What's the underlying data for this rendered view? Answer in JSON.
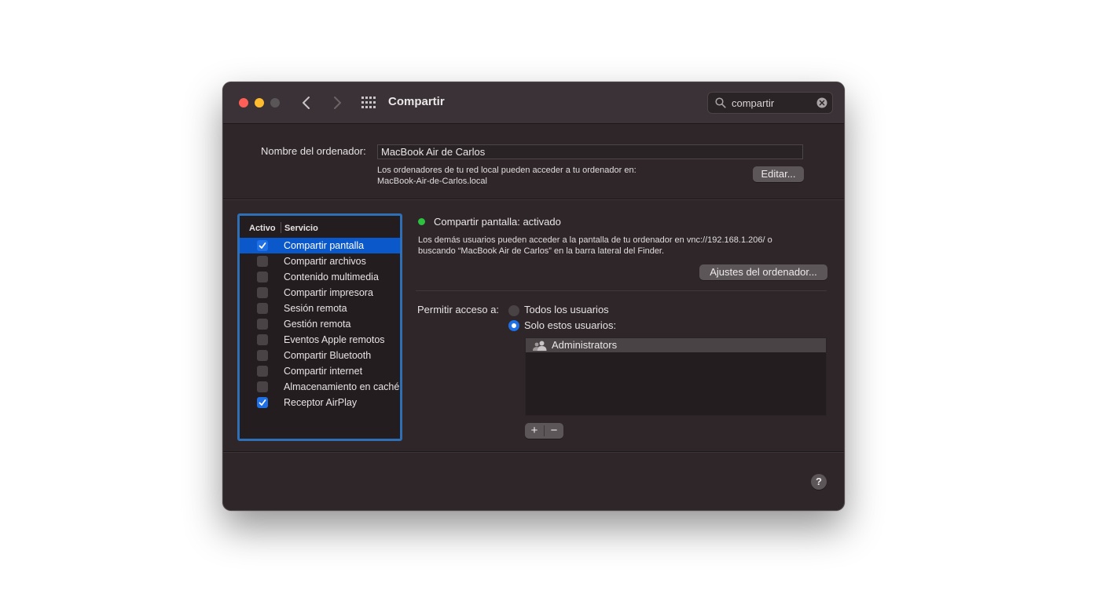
{
  "window": {
    "title": "Compartir"
  },
  "titlebar": {
    "search_value": "compartir",
    "icons": {
      "back": "chevron-left-icon",
      "forward": "chevron-right-icon",
      "show_all": "grid-icon",
      "search": "search-icon",
      "clear": "clear-icon"
    }
  },
  "computer_name": {
    "label": "Nombre del ordenador:",
    "value": "MacBook Air de Carlos",
    "description_line1": "Los ordenadores de tu red local pueden acceder a tu ordenador en:",
    "description_line2": "MacBook-Air-de-Carlos.local",
    "edit_label": "Editar..."
  },
  "services": {
    "header_active": "Activo",
    "header_service": "Servicio",
    "items": [
      {
        "label": "Compartir pantalla",
        "checked": true,
        "selected": true
      },
      {
        "label": "Compartir archivos",
        "checked": false,
        "selected": false
      },
      {
        "label": "Contenido multimedia",
        "checked": false,
        "selected": false
      },
      {
        "label": "Compartir impresora",
        "checked": false,
        "selected": false
      },
      {
        "label": "Sesión remota",
        "checked": false,
        "selected": false
      },
      {
        "label": "Gestión remota",
        "checked": false,
        "selected": false
      },
      {
        "label": "Eventos Apple remotos",
        "checked": false,
        "selected": false
      },
      {
        "label": "Compartir Bluetooth",
        "checked": false,
        "selected": false
      },
      {
        "label": "Compartir internet",
        "checked": false,
        "selected": false
      },
      {
        "label": "Almacenamiento en caché",
        "checked": false,
        "selected": false
      },
      {
        "label": "Receptor AirPlay",
        "checked": true,
        "selected": false
      }
    ]
  },
  "detail": {
    "status_title": "Compartir pantalla: activado",
    "status_color": "#2cc23f",
    "desc_line1": "Los demás usuarios pueden acceder a la pantalla de tu ordenador en vnc://192.168.1.206/ o",
    "desc_line2": "buscando “MacBook Air de Carlos” en la barra lateral del Finder.",
    "settings_label": "Ajustes del ordenador...",
    "access_label": "Permitir acceso a:",
    "option_all": "Todos los usuarios",
    "option_only": "Solo estos usuarios:",
    "selected_option": "only",
    "users": [
      {
        "label": "Administrators",
        "icon": "group-users-icon"
      }
    ],
    "add_label": "+",
    "remove_label": "−"
  },
  "footer": {
    "help_label": "?"
  },
  "colors": {
    "accent": "#1f6fe5",
    "selection": "#0a58c9",
    "close": "#ff5f57",
    "minimize": "#febc2e"
  }
}
